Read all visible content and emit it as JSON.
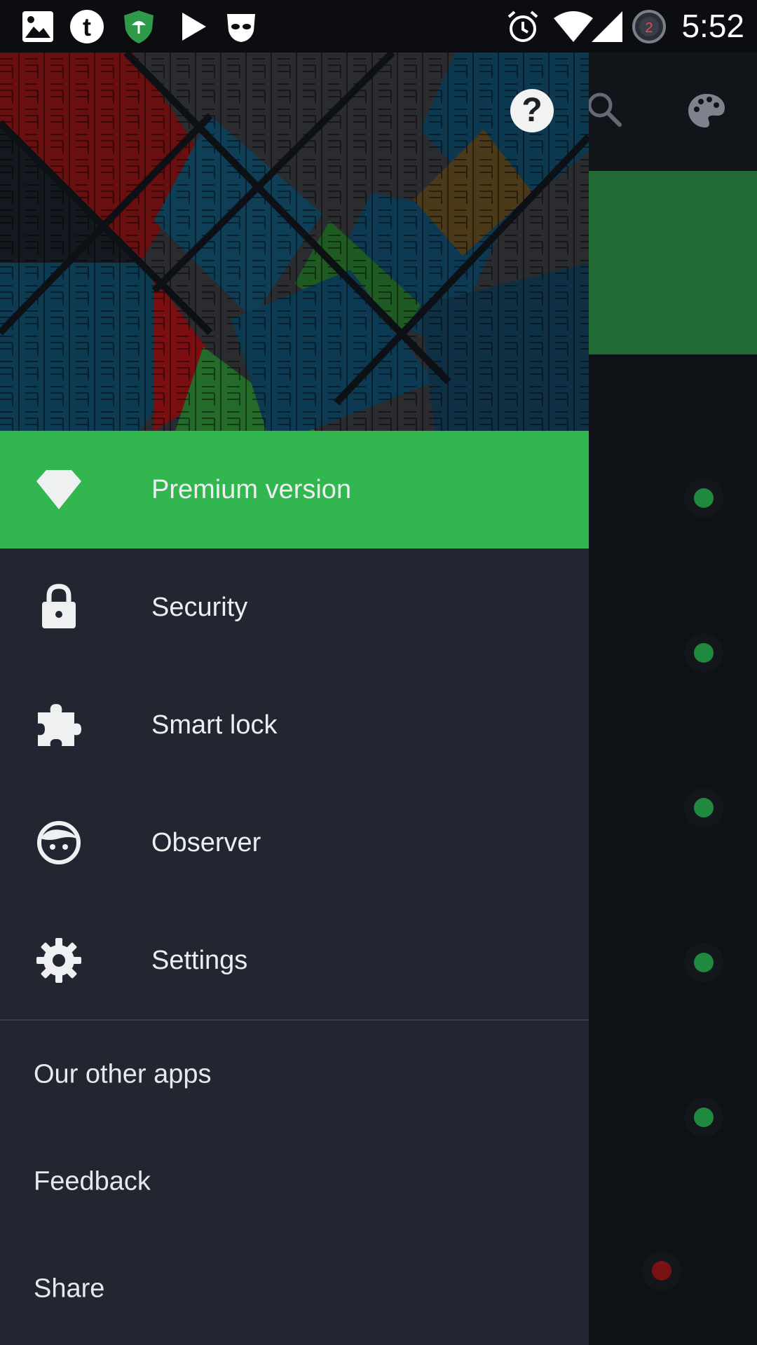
{
  "status_bar": {
    "time": "5:52",
    "left_icons": [
      "gallery-icon",
      "tumblr-icon",
      "shield-umbrella-icon",
      "play-store-icon",
      "incognito-mask-icon"
    ],
    "right_icons": [
      "alarm-icon",
      "wifi-icon",
      "signal-icon",
      "notification-count-icon"
    ],
    "notification_count": "2"
  },
  "toolbar": {
    "help_label": "?",
    "actions": [
      "help-icon",
      "search-icon",
      "palette-icon"
    ]
  },
  "drawer": {
    "items": [
      {
        "label": "Premium version",
        "icon": "diamond-icon",
        "highlighted": true
      },
      {
        "label": "Security",
        "icon": "lock-icon"
      },
      {
        "label": "Smart lock",
        "icon": "puzzle-icon"
      },
      {
        "label": "Observer",
        "icon": "face-icon"
      },
      {
        "label": "Settings",
        "icon": "gear-icon"
      }
    ],
    "secondary": [
      {
        "label": "Our other apps"
      },
      {
        "label": "Feedback"
      },
      {
        "label": "Share"
      }
    ]
  },
  "colors": {
    "accent_green": "#32b650",
    "drawer_bg": "#222631",
    "status_dot_green": "#1f8a3e",
    "status_dot_red": "#7a1214"
  }
}
